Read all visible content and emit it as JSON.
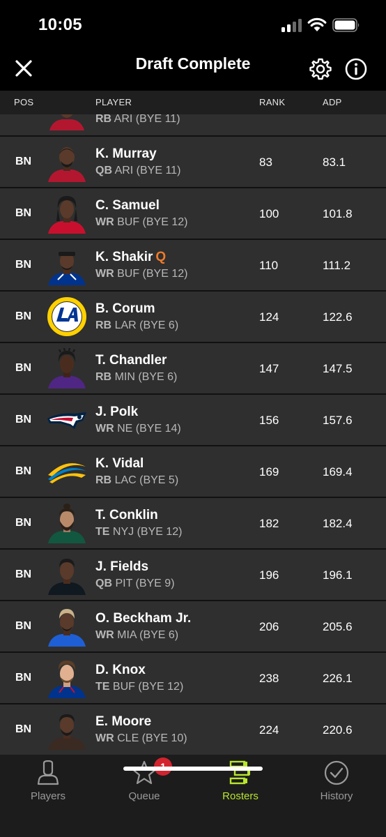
{
  "status_bar": {
    "time": "10:05"
  },
  "header": {
    "title": "Draft Complete"
  },
  "columns": {
    "pos": "POS",
    "player": "PLAYER",
    "rank": "RANK",
    "adp": "ADP"
  },
  "partial_row": {
    "sub_pos": "RB",
    "sub_rest": "ARI (BYE 11)"
  },
  "players": [
    {
      "pos": "BN",
      "name": "K. Murray",
      "tag": "",
      "sub_pos": "QB",
      "sub_rest": "ARI (BYE 11)",
      "rank": "83",
      "adp": "83.1",
      "avatar": "player-headshot-cardinals"
    },
    {
      "pos": "BN",
      "name": "C. Samuel",
      "tag": "",
      "sub_pos": "WR",
      "sub_rest": "BUF (BYE 12)",
      "rank": "100",
      "adp": "101.8",
      "avatar": "player-headshot-bills-red"
    },
    {
      "pos": "BN",
      "name": "K. Shakir",
      "tag": "Q",
      "sub_pos": "WR",
      "sub_rest": "BUF (BYE 12)",
      "rank": "110",
      "adp": "111.2",
      "avatar": "player-headshot-bills-blue"
    },
    {
      "pos": "BN",
      "name": "B. Corum",
      "tag": "",
      "sub_pos": "RB",
      "sub_rest": "LAR (BYE 6)",
      "rank": "124",
      "adp": "122.6",
      "avatar": "rams-logo"
    },
    {
      "pos": "BN",
      "name": "T. Chandler",
      "tag": "",
      "sub_pos": "RB",
      "sub_rest": "MIN (BYE 6)",
      "rank": "147",
      "adp": "147.5",
      "avatar": "player-headshot-vikings"
    },
    {
      "pos": "BN",
      "name": "J. Polk",
      "tag": "",
      "sub_pos": "WR",
      "sub_rest": "NE (BYE 14)",
      "rank": "156",
      "adp": "157.6",
      "avatar": "patriots-logo"
    },
    {
      "pos": "BN",
      "name": "K. Vidal",
      "tag": "",
      "sub_pos": "RB",
      "sub_rest": "LAC (BYE 5)",
      "rank": "169",
      "adp": "169.4",
      "avatar": "chargers-logo"
    },
    {
      "pos": "BN",
      "name": "T. Conklin",
      "tag": "",
      "sub_pos": "TE",
      "sub_rest": "NYJ (BYE 12)",
      "rank": "182",
      "adp": "182.4",
      "avatar": "player-headshot-jets"
    },
    {
      "pos": "BN",
      "name": "J. Fields",
      "tag": "",
      "sub_pos": "QB",
      "sub_rest": "PIT (BYE 9)",
      "rank": "196",
      "adp": "196.1",
      "avatar": "player-headshot-steelers"
    },
    {
      "pos": "BN",
      "name": "O. Beckham Jr.",
      "tag": "",
      "sub_pos": "WR",
      "sub_rest": "MIA (BYE 6)",
      "rank": "206",
      "adp": "205.6",
      "avatar": "player-headshot-dolphins"
    },
    {
      "pos": "BN",
      "name": "D. Knox",
      "tag": "",
      "sub_pos": "TE",
      "sub_rest": "BUF (BYE 12)",
      "rank": "238",
      "adp": "226.1",
      "avatar": "player-headshot-bills-blue"
    },
    {
      "pos": "BN",
      "name": "E. Moore",
      "tag": "",
      "sub_pos": "WR",
      "sub_rest": "CLE (BYE 10)",
      "rank": "224",
      "adp": "220.6",
      "avatar": "player-headshot-browns"
    }
  ],
  "tabs": [
    {
      "label": "Players",
      "icon": "person-icon",
      "active": false
    },
    {
      "label": "Queue",
      "icon": "star-icon",
      "active": false,
      "badge": "1"
    },
    {
      "label": "Rosters",
      "icon": "rosters-icon",
      "active": true
    },
    {
      "label": "History",
      "icon": "check-circle-icon",
      "active": false
    }
  ],
  "colors": {
    "background": "#000000",
    "row": "#2f2f2f",
    "accent": "#b8e62e",
    "injury_tag": "#f07a2a",
    "badge": "#d3232f"
  }
}
